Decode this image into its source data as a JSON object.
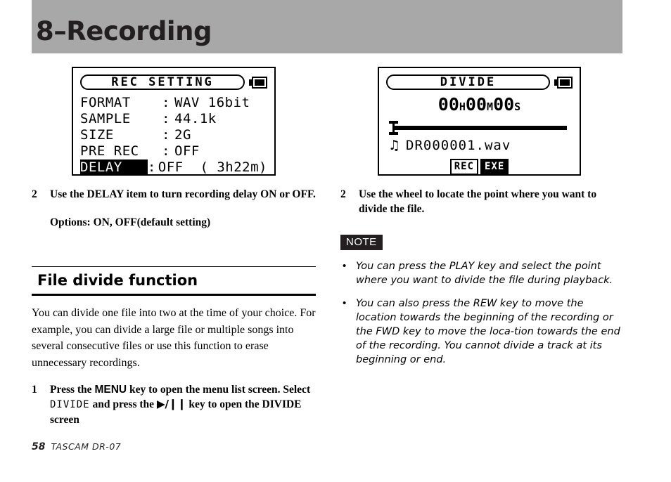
{
  "header": {
    "chapter_title": "8–Recording",
    "band_color": "#a8a8a8"
  },
  "lcd_rec_setting": {
    "screen_title": "REC SETTING",
    "battery_icon": "battery-full-icon",
    "rows": [
      {
        "label": "FORMAT",
        "colon": ":",
        "value": "WAV 16bit",
        "highlighted": false
      },
      {
        "label": "SAMPLE",
        "colon": ":",
        "value": "44.1k",
        "highlighted": false
      },
      {
        "label": "SIZE",
        "colon": ":",
        "value": "2G",
        "highlighted": false
      },
      {
        "label": "PRE REC",
        "colon": ":",
        "value": "OFF",
        "highlighted": false
      },
      {
        "label": "DELAY",
        "colon": ":",
        "value": "OFF  ( 3h22m)",
        "highlighted": true
      }
    ]
  },
  "lcd_divide": {
    "screen_title": "DIVIDE",
    "battery_icon": "battery-full-icon",
    "time": {
      "hours": "00",
      "hours_unit": "H",
      "minutes": "00",
      "minutes_unit": "M",
      "seconds": "00",
      "seconds_unit": "S"
    },
    "file_icon": "music-note-icon",
    "file_name": "DR000001.wav",
    "buttons": {
      "rec_label": "REC",
      "exe_label": "EXE"
    }
  },
  "left_column": {
    "step2": {
      "number": "2",
      "text": "Use the DELAY item to turn recording delay ON or OFF.",
      "options": "Options: ON, OFF(default setting)"
    },
    "section": {
      "title": "File divide function",
      "paragraph": "You can divide one file into two at the time of your choice. For example, you can divide a large file or multiple songs into several consecutive files or use this function to erase unnecessary recordings."
    },
    "step1": {
      "number": "1",
      "part1": "Press the ",
      "menu_key": "MENU",
      "part2": " key to open the menu list screen. Select ",
      "divide_item": "DIVIDE",
      "part3": " and press the ",
      "transport_key": "▶/❙❙",
      "part4": " key to open the DIVIDE screen"
    }
  },
  "right_column": {
    "step2": {
      "number": "2",
      "text": "Use the wheel to locate the point where you want to divide the file."
    },
    "note_badge": "NOTE",
    "bullets": [
      {
        "marker": "•",
        "text": "You can press the PLAY key and select the point where you want to divide the file during playback."
      },
      {
        "marker": "•",
        "text": "You can also press the REW key to move the location towards the beginning of the recording or the FWD key to move the loca-tion towards the end of the recording. You cannot divide a track at its beginning or end."
      }
    ]
  },
  "footer": {
    "page_number": "58",
    "model": "TASCAM  DR-07"
  }
}
